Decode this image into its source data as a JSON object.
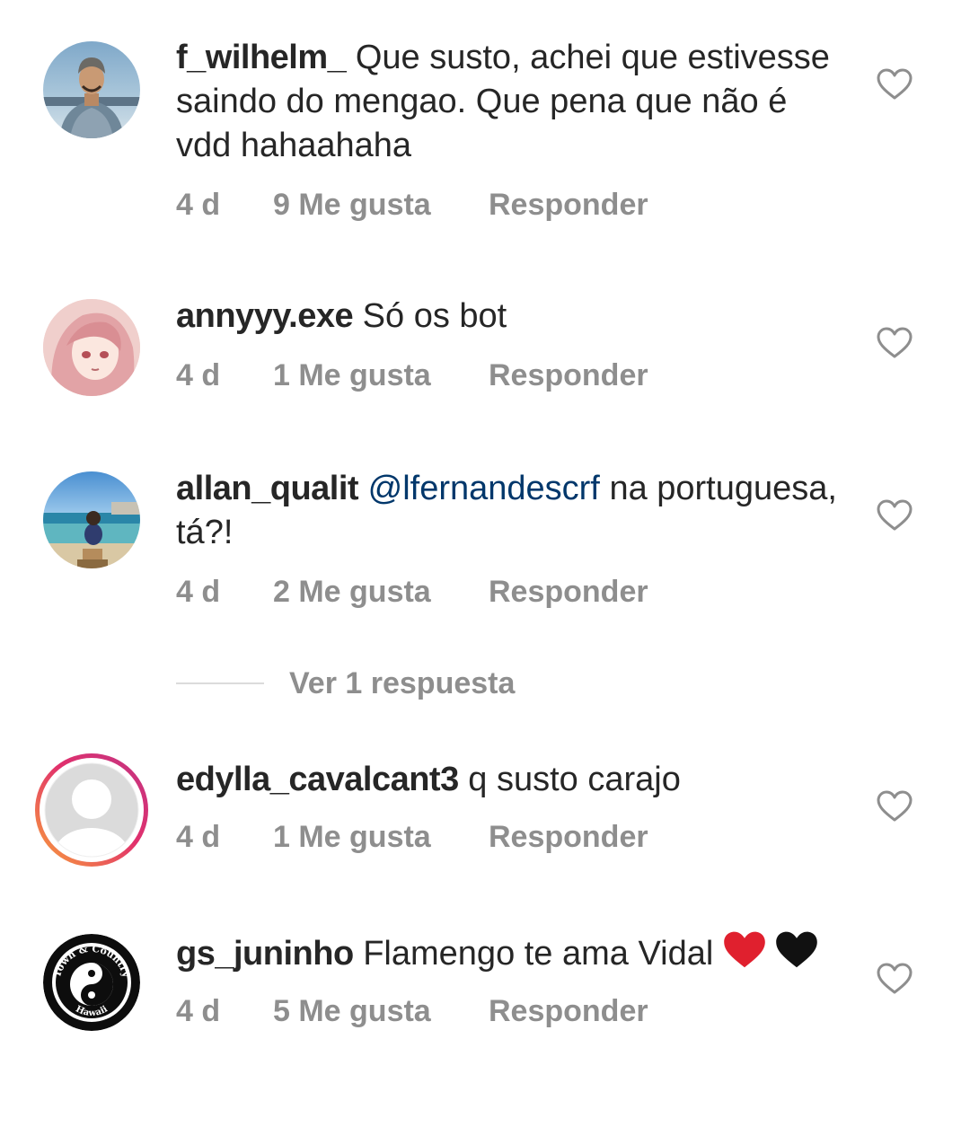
{
  "comments": [
    {
      "username": "f_wilhelm_",
      "text": "Que susto, achei que estivesse saindo do mengao. Que pena que não é vdd hahaahaha",
      "age": "4 d",
      "likes": "9 Me gusta",
      "reply_label": "Responder"
    },
    {
      "username": "annyyy.exe",
      "text": "Só os bot",
      "age": "4 d",
      "likes": "1 Me gusta",
      "reply_label": "Responder"
    },
    {
      "username": "allan_qualit",
      "mention": "@lfernandescrf",
      "text": "na portuguesa, tá?!",
      "age": "4 d",
      "likes": "2 Me gusta",
      "reply_label": "Responder",
      "view_replies": "Ver 1 respuesta"
    },
    {
      "username": "edylla_cavalcant3",
      "text": "q susto carajo",
      "age": "4 d",
      "likes": "1 Me gusta",
      "reply_label": "Responder"
    },
    {
      "username": "gs_juninho",
      "text": "Flamengo te ama Vidal",
      "age": "4 d",
      "likes": "5 Me gusta",
      "reply_label": "Responder"
    }
  ],
  "avatar_logo_text": {
    "top": "Town & Country",
    "bottom": "Hawaii"
  },
  "colors": {
    "text": "#262626",
    "meta": "#8e8e8e",
    "mention": "#00376b",
    "heart_outline": "#8e8e8e",
    "red_heart": "#e0202e",
    "black_heart": "#111111",
    "story_ring": [
      "#f9a33a",
      "#e1306c",
      "#c13584"
    ]
  },
  "icons": {
    "like": "heart-outline-icon",
    "red_heart_emoji": "red-heart-emoji",
    "black_heart_emoji": "black-heart-emoji"
  }
}
